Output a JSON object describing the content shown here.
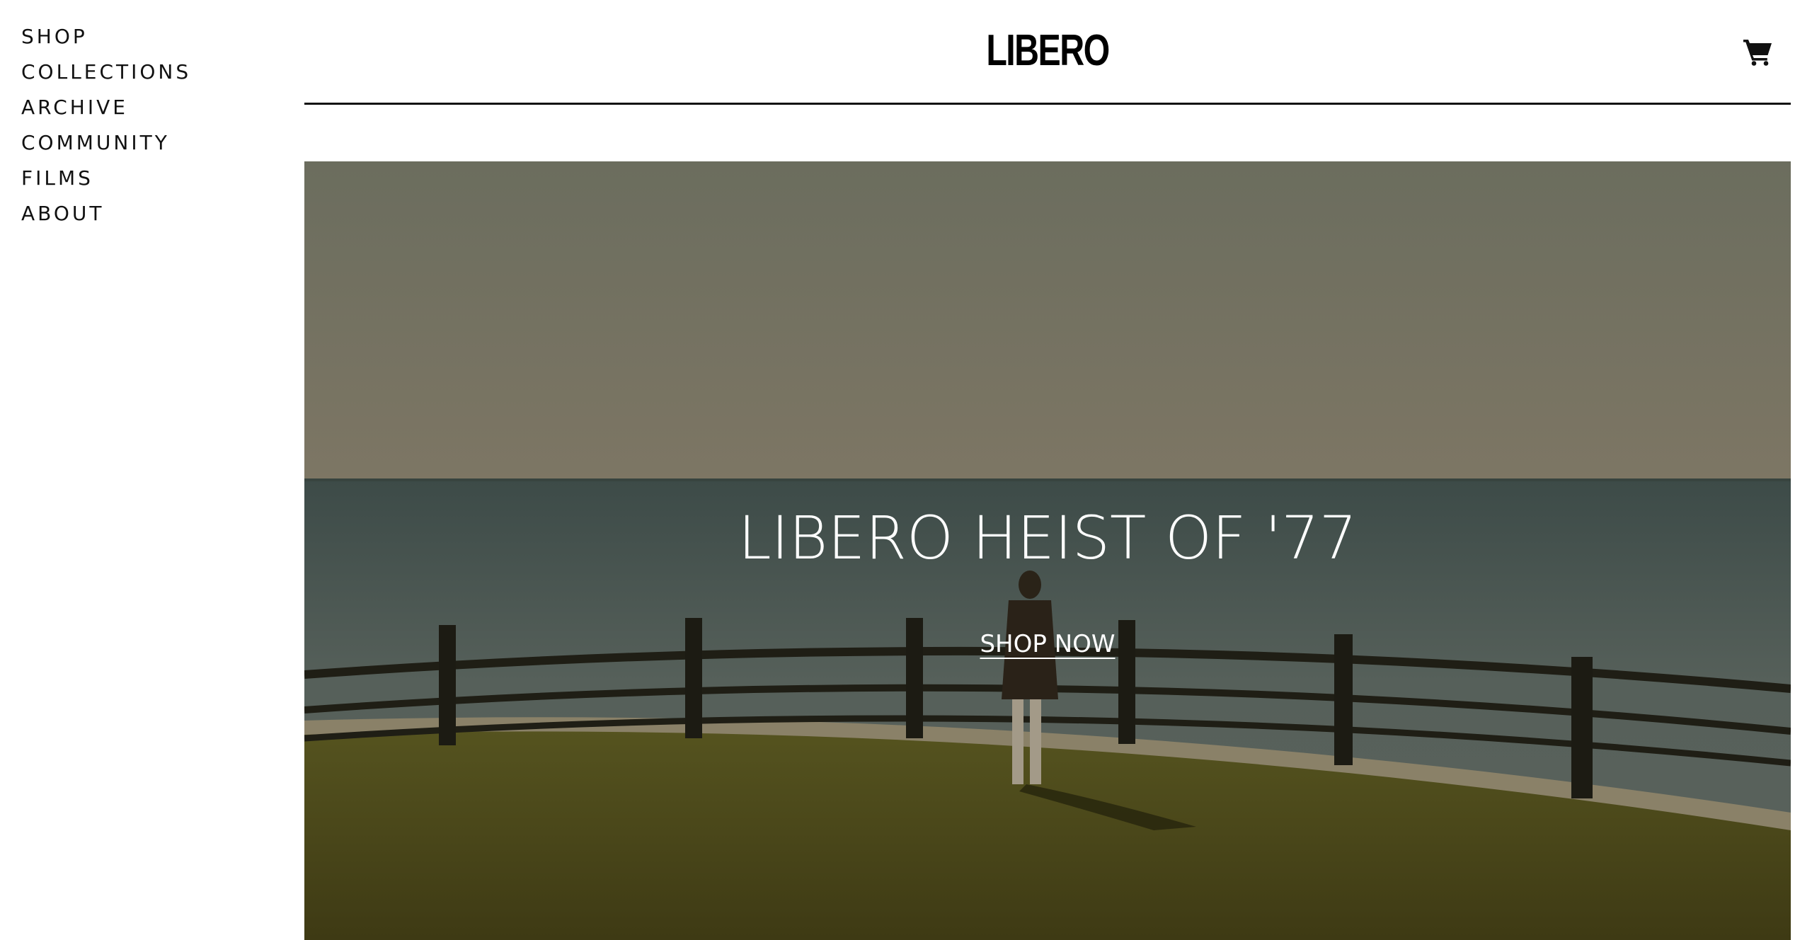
{
  "brand": {
    "logo_text": "LIBERO"
  },
  "nav": {
    "items": [
      {
        "label": "SHOP"
      },
      {
        "label": "COLLECTIONS"
      },
      {
        "label": "ARCHIVE"
      },
      {
        "label": "COMMUNITY"
      },
      {
        "label": "FILMS"
      },
      {
        "label": "ABOUT"
      }
    ]
  },
  "header": {
    "cart_icon": "shopping-cart-icon"
  },
  "hero": {
    "title": "LIBERO HEIST OF '77",
    "cta_label": "SHOP NOW"
  },
  "colors": {
    "text": "#111111",
    "background": "#ffffff",
    "hero_text": "#ffffff"
  }
}
